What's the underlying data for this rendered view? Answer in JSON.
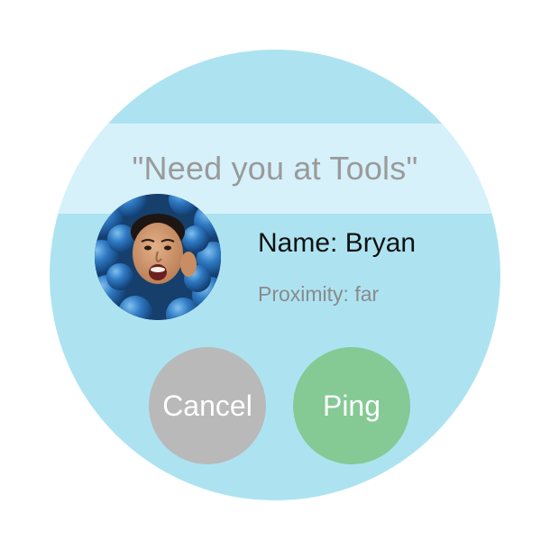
{
  "message": {
    "text": "\"Need you at Tools\""
  },
  "contact": {
    "avatar_icon": "person-photo",
    "name_label": "Name: Bryan",
    "proximity_label": "Proximity: far"
  },
  "actions": {
    "cancel_label": "Cancel",
    "ping_label": "Ping"
  },
  "colors": {
    "face_background": "#ade3f1",
    "message_band": "#d6f1fa",
    "cancel_button": "#b9b9b9",
    "ping_button": "#85c994"
  }
}
